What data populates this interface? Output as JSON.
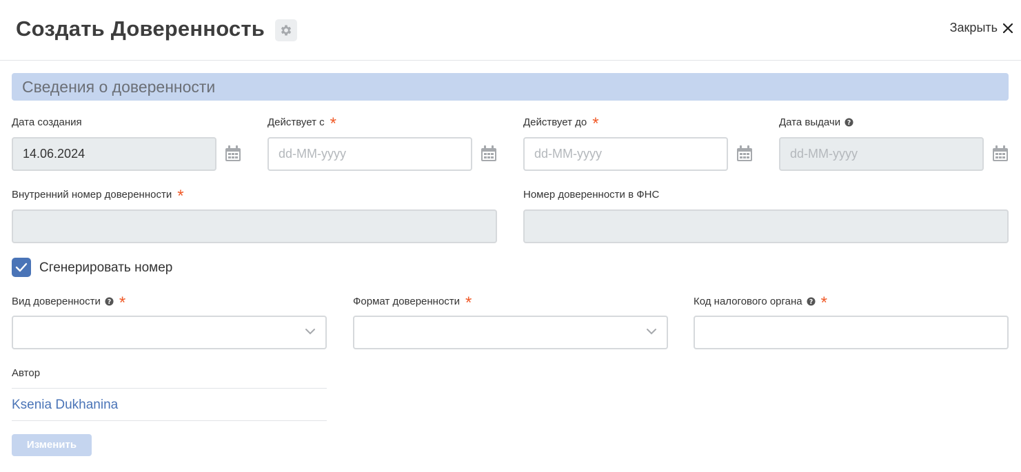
{
  "header": {
    "title": "Создать Доверенность",
    "close_label": "Закрыть"
  },
  "section": {
    "title": "Сведения о доверенности"
  },
  "fields": {
    "created_date": {
      "label": "Дата создания",
      "value": "14.06.2024"
    },
    "valid_from": {
      "label": "Действует с",
      "placeholder": "dd-MM-yyyy",
      "required_mark": "*"
    },
    "valid_to": {
      "label": "Действует до",
      "placeholder": "dd-MM-yyyy",
      "required_mark": "*"
    },
    "issue_date": {
      "label": "Дата выдачи",
      "placeholder": "dd-MM-yyyy"
    },
    "internal_number": {
      "label": "Внутренний номер доверенности",
      "value": "",
      "required_mark": "*"
    },
    "fns_number": {
      "label": "Номер доверенности в ФНС",
      "value": ""
    },
    "generate_number": {
      "label": "Сгенерировать номер",
      "checked": true
    },
    "poa_type": {
      "label": "Вид доверенности",
      "value": "",
      "required_mark": "*"
    },
    "poa_format": {
      "label": "Формат доверенности",
      "value": "",
      "required_mark": "*"
    },
    "tax_code": {
      "label": "Код налогового органа",
      "value": "",
      "required_mark": "*"
    },
    "author": {
      "label": "Автор",
      "value": "Ksenia Dukhanina"
    }
  },
  "actions": {
    "edit_label": "Изменить"
  },
  "colors": {
    "accent": "#4a74b7",
    "section_bg": "#c5d5ef",
    "required": "#f05a28",
    "disabled_bg": "#e8ecee"
  },
  "icons": {
    "settings": "gear-icon",
    "close": "close-icon",
    "calendar": "calendar-icon",
    "help": "question-circle-icon",
    "dropdown": "chevron-down-icon",
    "check": "check-icon"
  }
}
